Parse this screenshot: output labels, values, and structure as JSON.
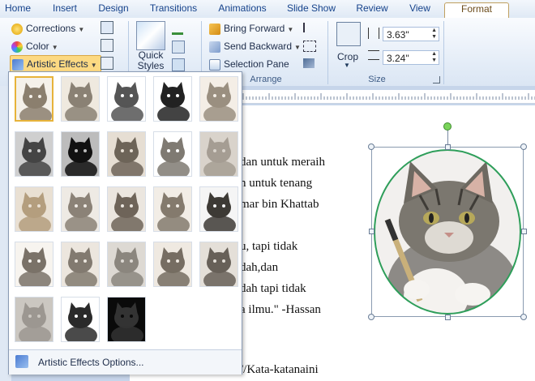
{
  "tabs": [
    {
      "label": "Home"
    },
    {
      "label": "Insert"
    },
    {
      "label": "Design"
    },
    {
      "label": "Transitions"
    },
    {
      "label": "Animations"
    },
    {
      "label": "Slide Show"
    },
    {
      "label": "Review"
    },
    {
      "label": "View"
    },
    {
      "label": "Format",
      "active": true
    }
  ],
  "adjust": {
    "corrections": "Corrections",
    "color": "Color",
    "artistic_effects": "Artistic Effects"
  },
  "picture_styles": {
    "quick_styles_line1": "Quick",
    "quick_styles_line2": "Styles"
  },
  "arrange": {
    "bring_forward": "Bring Forward",
    "send_backward": "Send Backward",
    "selection_pane": "Selection Pane",
    "group_label": "Arrange"
  },
  "size": {
    "crop": "Crop",
    "height": "3.63\"",
    "width": "3.24\"",
    "group_label": "Size"
  },
  "gallery": {
    "footer_label": "Artistic Effects Options...",
    "rows": 5,
    "selected_index": 0
  },
  "document": {
    "lines": [
      "dan untuk meraih",
      "n untuk tenang",
      "mar bin Khattab",
      "",
      "u, tapi tidak",
      "dah,dan",
      "dah tapi tidak",
      "a ilmu.\" -Hassan",
      "",
      "",
      "//Kata-katanaini"
    ]
  },
  "colors": {
    "accent": "#e7b33a",
    "ribbon_border": "#8fa9ce",
    "selection_outline": "#2e9e5a"
  }
}
